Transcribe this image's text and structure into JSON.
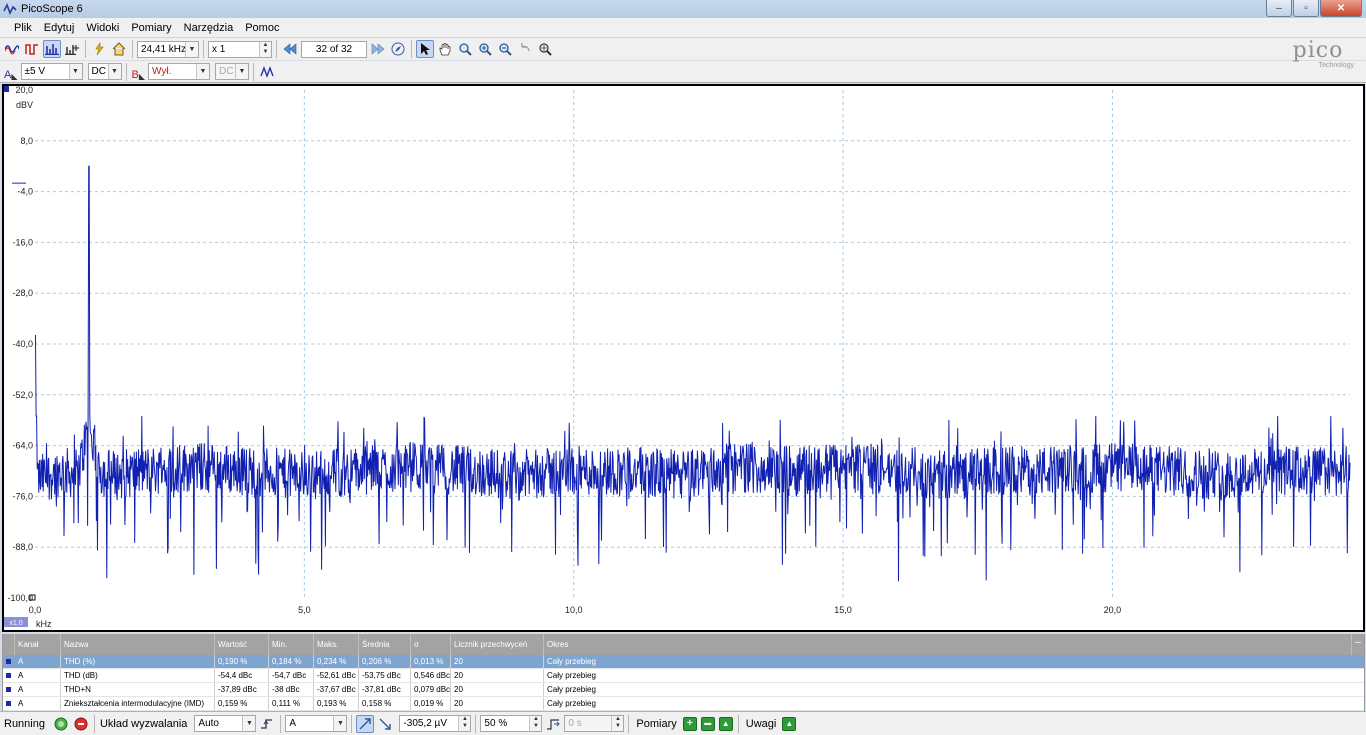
{
  "window": {
    "title": "PicoScope 6",
    "minimize": "–",
    "maximize": "▫",
    "close": "✕"
  },
  "menu": [
    "Plik",
    "Edytuj",
    "Widoki",
    "Pomiary",
    "Narzędzia",
    "Pomoc"
  ],
  "toolbar": {
    "frequency_range": "24,41 kHz",
    "zoom_factor": "x 1",
    "capture_counter": "32 of 32"
  },
  "channels": {
    "a_label": "A",
    "a_range": "±5 V",
    "a_coupling": "DC",
    "b_label": "B",
    "b_range": "Wył.",
    "b_coupling": "DC"
  },
  "logo": {
    "word": "pico",
    "sub": "Technology"
  },
  "scope": {
    "y_unit": "dBV",
    "y_ticks": [
      "20,0",
      "8,0",
      "-4,0",
      "-16,0",
      "-28,0",
      "-40,0",
      "-52,0",
      "-64,0",
      "-76,0",
      "-88,0",
      "-100,0"
    ],
    "x_ticks": [
      "0,0",
      "5,0",
      "10,0",
      "15,0",
      "20,0"
    ],
    "x_unit": "kHz",
    "x_zoom_badge": "x1,0",
    "trace_color": "#1020b0",
    "grid_color": "#a8cde0"
  },
  "chart_data": {
    "type": "line",
    "title": "",
    "xlabel": "kHz",
    "ylabel": "dBV",
    "xlim": [
      0,
      24.41
    ],
    "ylim": [
      -100,
      20
    ],
    "grid": true,
    "series": [
      {
        "color": "#1020b0",
        "x": [
          0.0,
          0.05,
          0.5,
          0.8,
          0.98,
          1.0,
          1.02,
          1.2,
          1.5,
          2.0,
          3.0,
          4.0,
          5.0,
          6.0,
          7.0,
          8.0,
          9.0,
          10.0,
          11.0,
          12.0,
          13.0,
          14.0,
          15.0,
          16.0,
          17.0,
          18.0,
          19.0,
          20.0,
          21.0,
          22.0,
          23.0,
          24.41
        ],
        "y": [
          -38,
          -72,
          -70,
          -71,
          -60,
          2,
          -60,
          -70,
          -71,
          -70,
          -69,
          -70,
          -71,
          -70,
          -69,
          -70,
          -71,
          -70,
          -70,
          -71,
          -69,
          -70,
          -69,
          -70,
          -71,
          -70,
          -70,
          -69,
          -70,
          -71,
          -70,
          -70
        ]
      }
    ]
  },
  "measurements": {
    "headers": [
      "Kanał",
      "Nazwa",
      "Wartość",
      "Min.",
      "Maks.",
      "Średnia",
      "σ",
      "Licznik przechwyceń",
      "Okres"
    ],
    "rows": [
      [
        "A",
        "THD (%)",
        "0,190 %",
        "0,184 %",
        "0,234 %",
        "0,206 %",
        "0,013 %",
        "20",
        "Cały przebieg"
      ],
      [
        "A",
        "THD (dB)",
        "-54,4 dBc",
        "-54,7 dBc",
        "-52,61 dBc",
        "-53,75 dBc",
        "0,546 dBc",
        "20",
        "Cały przebieg"
      ],
      [
        "A",
        "THD+N",
        "-37,89 dBc",
        "-38 dBc",
        "-37,67 dBc",
        "-37,81 dBc",
        "0,079 dBc",
        "20",
        "Cały przebieg"
      ],
      [
        "A",
        "Zniekształcenia intermodulacyjne (IMD)",
        "0,159 %",
        "0,111 %",
        "0,193 %",
        "0,158 %",
        "0,019 %",
        "20",
        "Cały przebieg"
      ]
    ],
    "collapse": "–"
  },
  "status": {
    "running": "Running",
    "trigger_label": "Układ wyzwalania",
    "trigger_mode": "Auto",
    "trigger_source": "A",
    "trigger_level": "-305,2 µV",
    "pre_trigger": "50 %",
    "delay": "0 s",
    "measurements_label": "Pomiary",
    "notes_label": "Uwagi",
    "add": "+",
    "remove": "–",
    "edit": "▬"
  }
}
